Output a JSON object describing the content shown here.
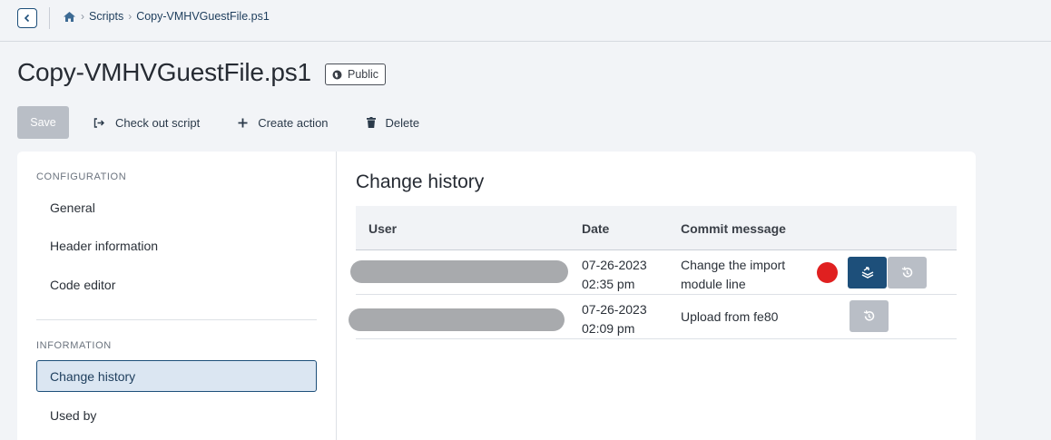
{
  "breadcrumb": {
    "items": [
      "Scripts",
      "Copy-VMHVGuestFile.ps1"
    ]
  },
  "page": {
    "title": "Copy-VMHVGuestFile.ps1",
    "visibility_badge": "Public"
  },
  "toolbar": {
    "save_label": "Save",
    "checkout_label": "Check out script",
    "create_action_label": "Create action",
    "delete_label": "Delete"
  },
  "sidebar": {
    "configuration_heading": "CONFIGURATION",
    "configuration_items": [
      "General",
      "Header information",
      "Code editor"
    ],
    "information_heading": "INFORMATION",
    "information_items": [
      "Change history",
      "Used by"
    ],
    "active_item": "Change history"
  },
  "change_history": {
    "title": "Change history",
    "columns": [
      "User",
      "Date",
      "Commit message"
    ],
    "rows": [
      {
        "user": "",
        "date": "07-26-2023",
        "time": "02:35 pm",
        "message_line1": "Change the import",
        "message_line2": "module line"
      },
      {
        "user": "",
        "date": "07-26-2023",
        "time": "02:09 pm",
        "message_line1": "Upload from fe80",
        "message_line2": ""
      }
    ]
  },
  "colors": {
    "accent": "#1d4f7a",
    "disabled": "#b9bec6",
    "marker": "#e02020"
  },
  "icons": [
    "back-icon",
    "home-icon",
    "globe-icon",
    "checkout-icon",
    "plus-icon",
    "trash-icon",
    "compare-icon",
    "restore-icon"
  ]
}
